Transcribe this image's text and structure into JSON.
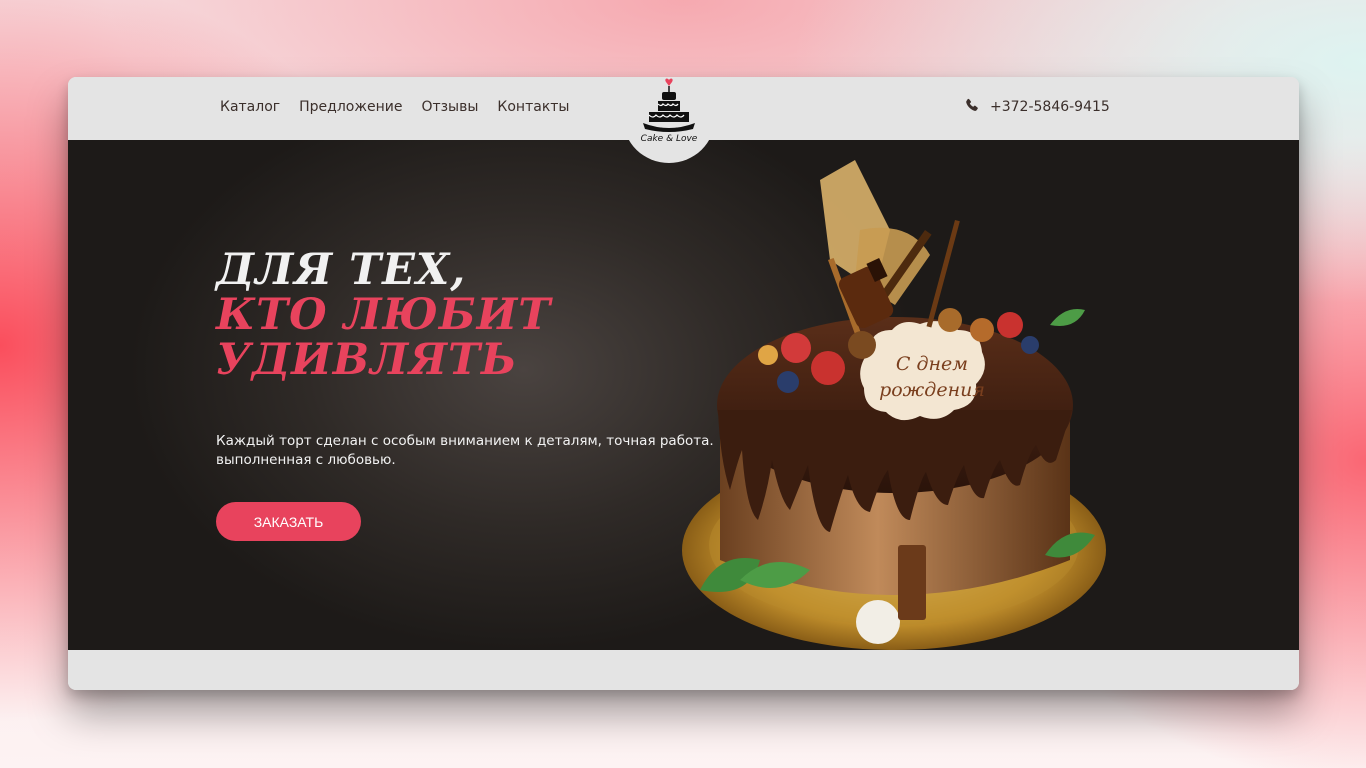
{
  "nav": {
    "items": [
      {
        "label": "Каталог"
      },
      {
        "label": "Предложение"
      },
      {
        "label": "Отзывы"
      },
      {
        "label": "Контакты"
      }
    ]
  },
  "logo": {
    "text": "Cake & Love"
  },
  "contact": {
    "phone": "+372-5846-9415",
    "icon": "phone-icon"
  },
  "hero": {
    "title_line1": "Для тех,",
    "title_line2": "кто любит",
    "title_line3": "удивлять",
    "description": "Каждый торт сделан с особым вниманием к деталям, точная работа. выполненная с любовью.",
    "button_label": "ЗАКАЗАТЬ",
    "cake_plaque_text_1": "С днем",
    "cake_plaque_text_2": "рождения"
  },
  "colors": {
    "accent": "#e8435d",
    "header_bg": "#e4e4e4",
    "hero_bg": "#2f2a27",
    "nav_text": "#3b2f2b"
  }
}
